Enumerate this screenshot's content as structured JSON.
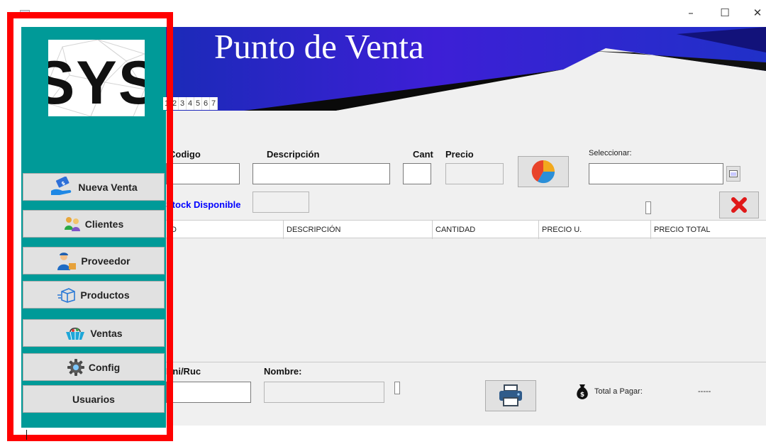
{
  "window": {
    "minimize_glyph": "–",
    "maximize_glyph": "☐",
    "close_glyph": "✕"
  },
  "logo": {
    "text": "SYST"
  },
  "header": {
    "title": "Punto de Venta"
  },
  "tabs": [
    "1",
    "2",
    "3",
    "4",
    "5",
    "6",
    "7"
  ],
  "nav": [
    {
      "label": "Nueva Venta",
      "icon": "money-hand-icon"
    },
    {
      "label": "Clientes",
      "icon": "people-icon"
    },
    {
      "label": "Proveedor",
      "icon": "delivery-man-icon"
    },
    {
      "label": "Productos",
      "icon": "box-icon"
    },
    {
      "label": "Ventas",
      "icon": "basket-icon"
    },
    {
      "label": "Config",
      "icon": "gear-icon"
    },
    {
      "label": "Usuarios",
      "icon": ""
    }
  ],
  "form": {
    "codigo_label": "Codigo",
    "descripcion_label": "Descripción",
    "cant_label": "Cant",
    "precio_label": "Precio",
    "seleccionar_label": "Seleccionar:",
    "stock_label": "Stock Disponible",
    "codigo_value": "",
    "descripcion_value": "",
    "cant_value": "",
    "precio_value": "",
    "seleccionar_value": "",
    "stock_value": ""
  },
  "table": {
    "columns": [
      "ID",
      "DESCRIPCIÓN",
      "CANTIDAD",
      "PRECIO U.",
      "PRECIO TOTAL"
    ],
    "rows": []
  },
  "footer": {
    "dni_label": "Dni/Ruc",
    "nombre_label": "Nombre:",
    "dni_value": "",
    "nombre_value": "",
    "total_label": "Total a Pagar:",
    "total_value": "-----"
  },
  "colors": {
    "sidebar": "#009a98",
    "banner_blue": "#3a1fd8",
    "highlight": "#ff0000",
    "stock_label": "#0000ff"
  }
}
